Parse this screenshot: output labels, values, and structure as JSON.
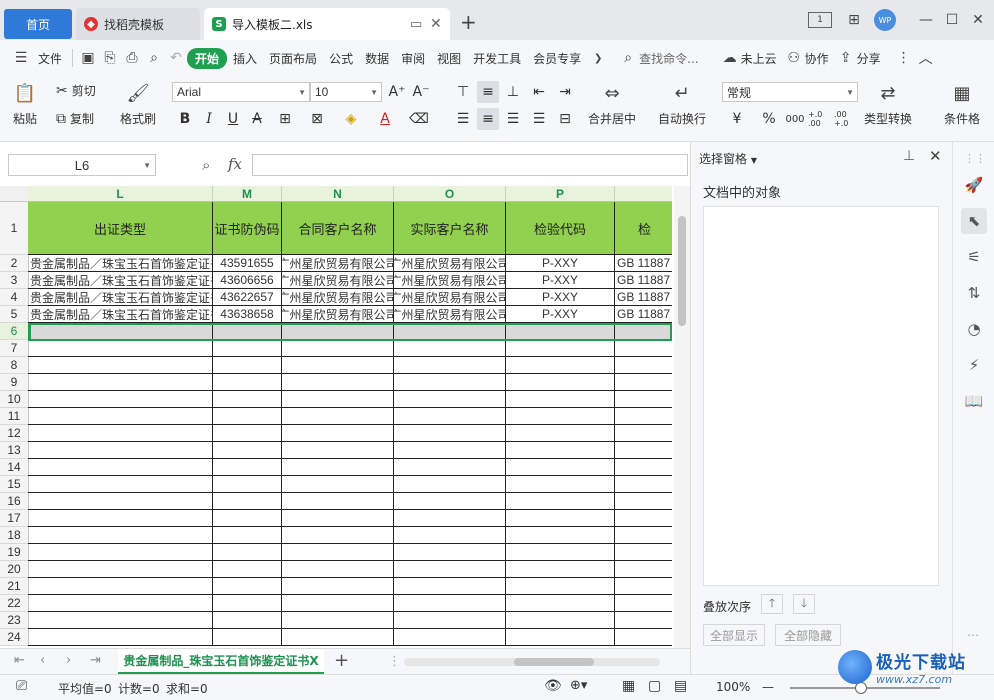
{
  "titlebar": {
    "tabs": [
      {
        "label": "首页"
      },
      {
        "label": "找稻壳模板",
        "icon_color": "#e63232"
      },
      {
        "label": "导入模板二.xls",
        "icon_color": "#1ea050",
        "icon_letter": "S"
      }
    ],
    "add_tab": "+",
    "avatar": "WP"
  },
  "menu": {
    "file": "文件",
    "start": "开始",
    "items": [
      "插入",
      "页面布局",
      "公式",
      "数据",
      "审阅",
      "视图",
      "开发工具",
      "会员专享"
    ],
    "search_placeholder": "查找命令...",
    "cloud": "未上云",
    "collab": "协作",
    "share": "分享"
  },
  "ribbon": {
    "paste": "粘贴",
    "cut": "剪切",
    "copy": "复制",
    "format_painter": "格式刷",
    "font": "Arial",
    "font_size": "10",
    "merge": "合并居中",
    "wrap": "自动换行",
    "number_format": "常规",
    "currency": "¥",
    "percent": "%",
    "thousands": "000",
    "inc_decimal": "+.0 .00",
    "dec_decimal": ".00 +.0",
    "convert": "类型转换",
    "conditional": "条件格"
  },
  "formula": {
    "cell_ref": "L6",
    "fx": "fx",
    "value": ""
  },
  "grid": {
    "columns": [
      "L",
      "M",
      "N",
      "O",
      "P"
    ],
    "header_row": [
      "出证类型",
      "证书防伪码",
      "合同客户名称",
      "实际客户名称",
      "检验代码",
      "检"
    ],
    "rows": [
      [
        "贵金属制品／珠宝玉石首饰鉴定证书",
        "43591655",
        "广州星欣贸易有限公司",
        "广州星欣贸易有限公司",
        "P-XXY",
        "GB 11887"
      ],
      [
        "贵金属制品／珠宝玉石首饰鉴定证书",
        "43606656",
        "广州星欣贸易有限公司",
        "广州星欣贸易有限公司",
        "P-XXY",
        "GB 11887"
      ],
      [
        "贵金属制品／珠宝玉石首饰鉴定证书",
        "43622657",
        "广州星欣贸易有限公司",
        "广州星欣贸易有限公司",
        "P-XXY",
        "GB 11887"
      ],
      [
        "贵金属制品／珠宝玉石首饰鉴定证书",
        "43638658",
        "广州星欣贸易有限公司",
        "广州星欣贸易有限公司",
        "P-XXY",
        "GB 11887"
      ]
    ],
    "row_numbers": [
      "1",
      "2",
      "3",
      "4",
      "5",
      "6",
      "7",
      "8",
      "9",
      "10",
      "11",
      "12",
      "13",
      "14",
      "15",
      "16",
      "17",
      "18",
      "19",
      "20",
      "21",
      "22",
      "23",
      "24"
    ],
    "selected_row": "6"
  },
  "sheet": {
    "tab_label": "贵金属制品_珠宝玉石首饰鉴定证书X",
    "add": "+"
  },
  "pane": {
    "title": "选择窗格",
    "subtitle": "文档中的对象",
    "order_label": "叠放次序",
    "show_all": "全部显示",
    "hide_all": "全部隐藏"
  },
  "status": {
    "average": "平均值=0",
    "count": "计数=0",
    "sum": "求和=0",
    "zoom": "100%",
    "zoom_level": 0.47
  },
  "watermark": {
    "cn": "极光下载站",
    "url": "www.xz7.com"
  },
  "colors": {
    "accent_green": "#1ea050",
    "header_fill": "#92d050",
    "home_tab_blue": "#2f7ad9"
  }
}
